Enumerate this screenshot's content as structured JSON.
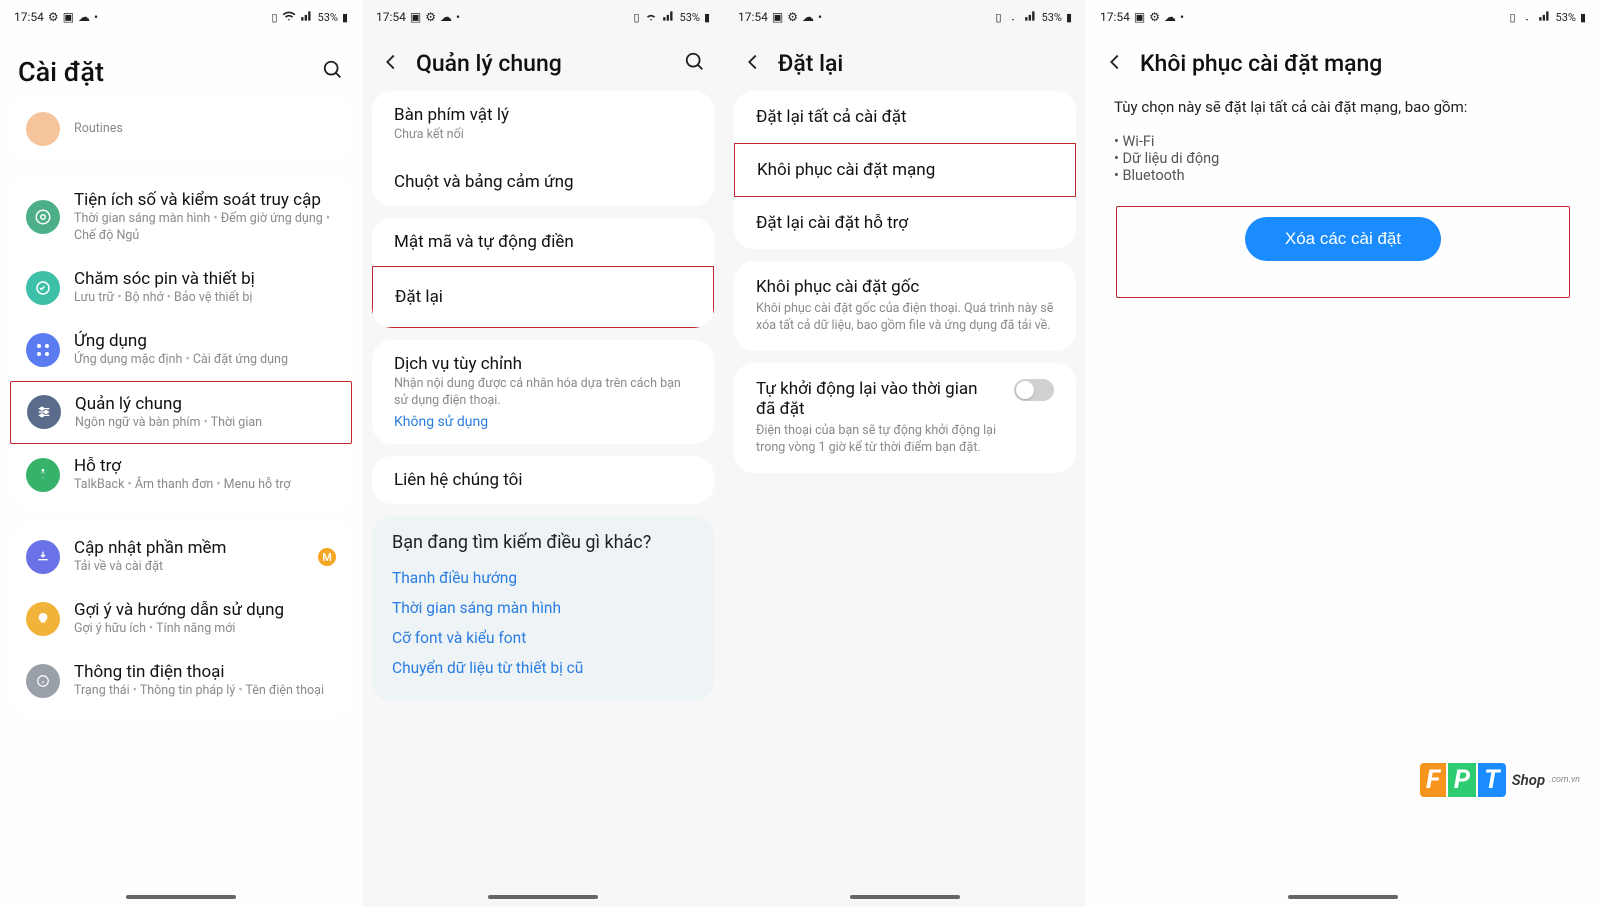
{
  "status": {
    "time": "17:54",
    "battery": "53%"
  },
  "screens": {
    "s1": {
      "title": "Cài đặt",
      "partial_sub": "Routines",
      "items": {
        "digital": {
          "title": "Tiện ích số và kiểm soát truy cập",
          "sub1": "Thời gian sáng màn hình",
          "sub2": "Đếm giờ ứng dụng",
          "sub3": "Chế độ Ngủ"
        },
        "care": {
          "title": "Chăm sóc pin và thiết bị",
          "sub1": "Lưu trữ",
          "sub2": "Bộ nhớ",
          "sub3": "Bảo vệ thiết bị"
        },
        "apps": {
          "title": "Ứng dụng",
          "sub1": "Ứng dụng mặc định",
          "sub2": "Cài đặt ứng dụng"
        },
        "general": {
          "title": "Quản lý chung",
          "sub1": "Ngôn ngữ và bàn phím",
          "sub2": "Thời gian"
        },
        "access": {
          "title": "Hỗ trợ",
          "sub1": "TalkBack",
          "sub2": "Âm thanh đơn",
          "sub3": "Menu hỗ trợ"
        },
        "update": {
          "title": "Cập nhật phần mềm",
          "sub1": "Tải về và cài đặt",
          "badge": "M"
        },
        "tips": {
          "title": "Gợi ý và hướng dẫn sử dụng",
          "sub1": "Gợi ý hữu ích",
          "sub2": "Tính năng mới"
        },
        "about": {
          "title": "Thông tin điện thoại",
          "sub1": "Trạng thái",
          "sub2": "Thông tin pháp lý",
          "sub3": "Tên điện thoại"
        }
      }
    },
    "s2": {
      "title": "Quản lý chung",
      "items": {
        "keyboard": {
          "title": "Bàn phím vật lý",
          "sub": "Chưa kết nối"
        },
        "mouse": {
          "title": "Chuột và bảng cảm ứng"
        },
        "autofill": {
          "title": "Mật mã và tự động điền"
        },
        "reset": {
          "title": "Đặt lại"
        },
        "custom": {
          "title": "Dịch vụ tùy chỉnh",
          "sub": "Nhận nội dung được cá nhân hóa dựa trên cách bạn sử dụng điện thoại.",
          "link": "Không sử dụng"
        },
        "contact": {
          "title": "Liên hệ chúng tôi"
        }
      },
      "suggest": {
        "title": "Bạn đang tìm kiếm điều gì khác?",
        "links": [
          "Thanh điều hướng",
          "Thời gian sáng màn hình",
          "Cỡ font và kiểu font",
          "Chuyển dữ liệu từ thiết bị cũ"
        ]
      }
    },
    "s3": {
      "title": "Đặt lại",
      "items": {
        "all": {
          "title": "Đặt lại tất cả cài đặt"
        },
        "network": {
          "title": "Khôi phục cài đặt mạng"
        },
        "access": {
          "title": "Đặt lại cài đặt hỗ trợ"
        },
        "factory": {
          "title": "Khôi phục cài đặt gốc",
          "sub": "Khôi phục cài đặt gốc của điện thoại. Quá trình này sẽ xóa tất cả dữ liệu, bao gồm file và ứng dụng đã tải về."
        },
        "auto": {
          "title": "Tự khởi động lại vào thời gian đã đặt",
          "sub": "Điện thoại của bạn sẽ tự động khởi động lại trong vòng 1 giờ kể từ thời điểm bạn đặt."
        }
      }
    },
    "s4": {
      "title": "Khôi phục cài đặt mạng",
      "intro": "Tùy chọn này sẽ đặt lại tất cả cài đặt mạng, bao gồm:",
      "bullets": [
        "Wi-Fi",
        "Dữ liệu di động",
        "Bluetooth"
      ],
      "button": "Xóa các cài đặt"
    }
  },
  "logo": {
    "brand_f": "F",
    "brand_p": "P",
    "brand_t": "T",
    "shop": "Shop",
    "domain": ".com.vn"
  }
}
